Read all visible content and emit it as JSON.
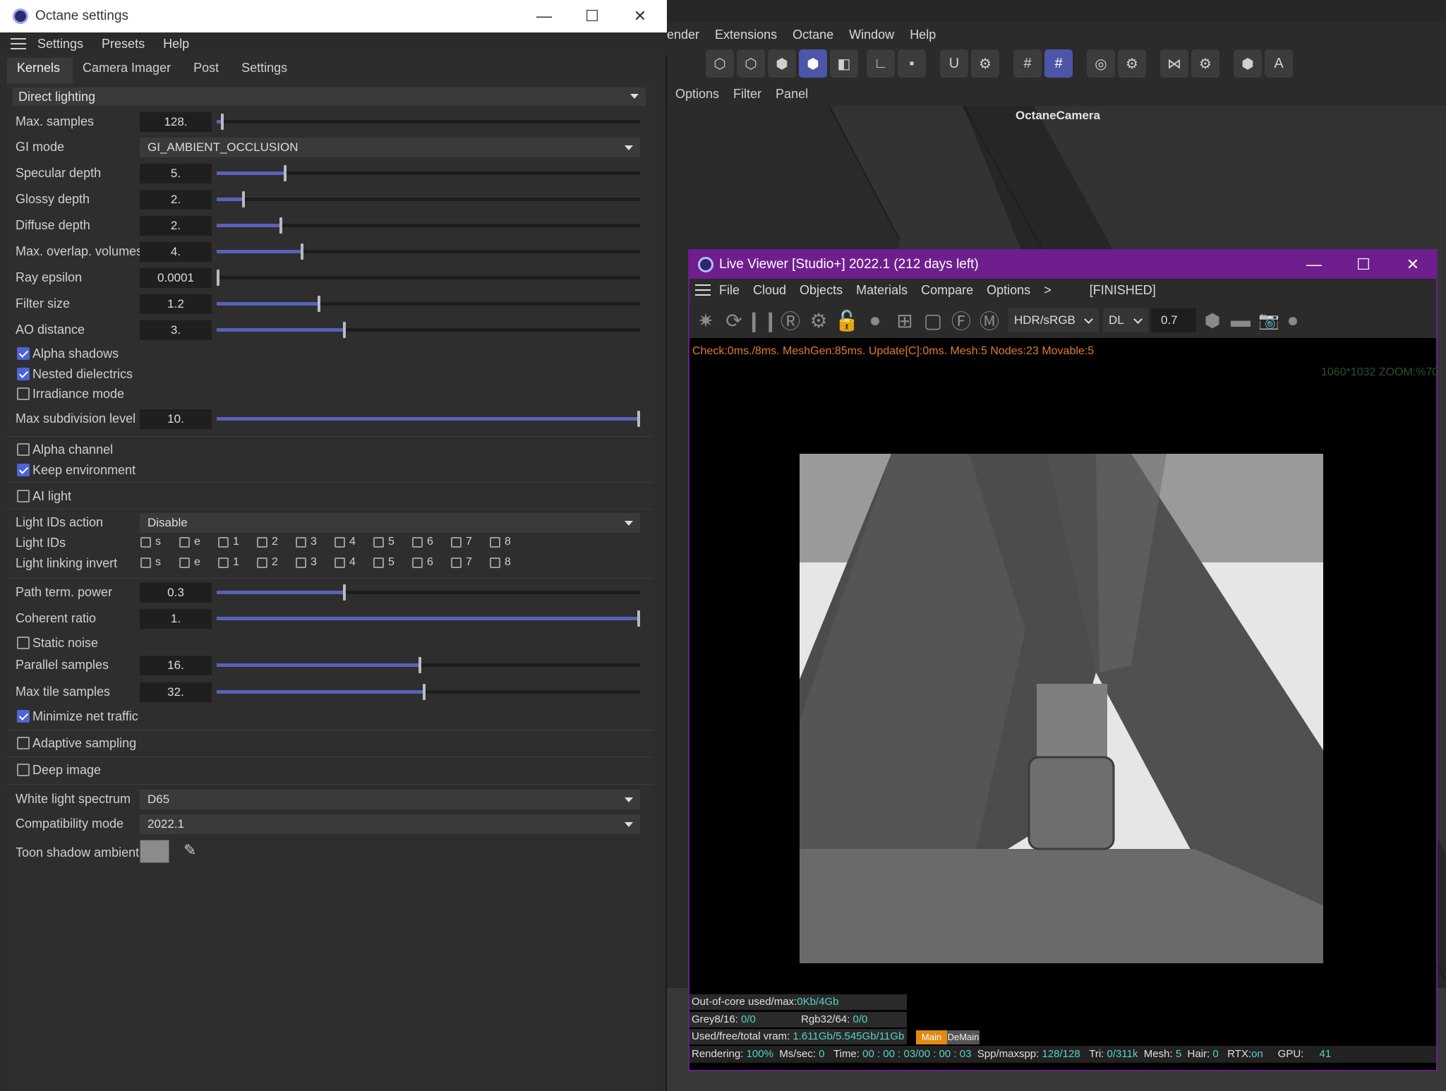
{
  "background_app": {
    "menu": [
      "ender",
      "Extensions",
      "Octane",
      "Window",
      "Help"
    ],
    "viewport_menu": [
      "Options",
      "Filter",
      "Panel"
    ],
    "camera_label": "OctaneCamera"
  },
  "octane_settings": {
    "title": "Octane settings",
    "menu": [
      "Settings",
      "Presets",
      "Help"
    ],
    "tabs": [
      "Kernels",
      "Camera Imager",
      "Post",
      "Settings"
    ],
    "active_tab": "Kernels",
    "kernel": "Direct lighting",
    "params": {
      "max_samples": {
        "label": "Max. samples",
        "value": "128.",
        "fraction": 0.01
      },
      "gi_mode": {
        "label": "GI mode",
        "value": "GI_AMBIENT_OCCLUSION"
      },
      "specular_depth": {
        "label": "Specular depth",
        "value": "5.",
        "fraction": 0.16
      },
      "glossy_depth": {
        "label": "Glossy depth",
        "value": "2.",
        "fraction": 0.06
      },
      "diffuse_depth": {
        "label": "Diffuse depth",
        "value": "2.",
        "fraction": 0.15
      },
      "max_overlap": {
        "label": "Max. overlap. volumes",
        "value": "4.",
        "fraction": 0.2
      },
      "ray_epsilon": {
        "label": "Ray epsilon",
        "value": "0.0001",
        "fraction": 0.0
      },
      "filter_size": {
        "label": "Filter size",
        "value": "1.2",
        "fraction": 0.24
      },
      "ao_distance": {
        "label": "AO distance",
        "value": "3.",
        "fraction": 0.3
      },
      "max_subdivision": {
        "label": "Max subdivision level",
        "value": "10.",
        "fraction": 1.0
      },
      "light_ids_action": {
        "label": "Light IDs action",
        "value": "Disable"
      },
      "light_ids": {
        "label": "Light IDs"
      },
      "light_linking_invert": {
        "label": "Light linking invert"
      },
      "path_term_power": {
        "label": "Path term. power",
        "value": "0.3",
        "fraction": 0.3
      },
      "coherent_ratio": {
        "label": "Coherent ratio",
        "value": "1.",
        "fraction": 1.0
      },
      "parallel_samples": {
        "label": "Parallel samples",
        "value": "16.",
        "fraction": 0.48
      },
      "max_tile_samples": {
        "label": "Max tile samples",
        "value": "32.",
        "fraction": 0.49
      },
      "white_light_spectrum": {
        "label": "White light spectrum",
        "value": "D65"
      },
      "compatibility_mode": {
        "label": "Compatibility mode",
        "value": "2022.1"
      },
      "toon_shadow_ambient": {
        "label": "Toon shadow ambient",
        "color": "#8b8b8b"
      }
    },
    "light_id_channels": [
      "s",
      "e",
      "1",
      "2",
      "3",
      "4",
      "5",
      "6",
      "7",
      "8"
    ],
    "checkboxes": {
      "alpha_shadows": {
        "label": "Alpha shadows",
        "checked": true
      },
      "nested_dielectrics": {
        "label": "Nested dielectrics",
        "checked": true
      },
      "irradiance_mode": {
        "label": "Irradiance mode",
        "checked": false
      },
      "alpha_channel": {
        "label": "Alpha channel",
        "checked": false
      },
      "keep_environment": {
        "label": "Keep environment",
        "checked": true
      },
      "ai_light": {
        "label": "AI light",
        "checked": false
      },
      "static_noise": {
        "label": "Static noise",
        "checked": false
      },
      "minimize_net_traffic": {
        "label": "Minimize net traffic",
        "checked": true
      },
      "adaptive_sampling": {
        "label": "Adaptive sampling",
        "checked": false
      },
      "deep_image": {
        "label": "Deep image",
        "checked": false
      }
    }
  },
  "live_viewer": {
    "title": "Live Viewer [Studio+] 2022.1 (212 days left)",
    "menu": [
      "File",
      "Cloud",
      "Objects",
      "Materials",
      "Compare",
      "Options",
      ">"
    ],
    "status_tag": "[FINISHED]",
    "colorspace": "HDR/sRGB",
    "mode": "DL",
    "exposure": "0.7",
    "stats_line": "Check:0ms./8ms. MeshGen:85ms. Update[C]:0ms. Mesh:5 Nodes:23 Movable:5",
    "resolution_line": "1060*1032 ZOOM:%70",
    "out_of_core": {
      "label": "Out-of-core used/max:",
      "value": "0Kb/4Gb"
    },
    "grey": {
      "label": "Grey8/16:",
      "value": "0/0"
    },
    "rgb": {
      "label": "Rgb32/64:",
      "value": "0/0"
    },
    "vram": {
      "label": "Used/free/total vram:",
      "value": "1.611Gb/5.545Gb/11Gb"
    },
    "tag_main": "Main",
    "tag_demain": "DeMain",
    "status": {
      "rendering_label": "Rendering:",
      "rendering": "100%",
      "ms_label": "Ms/sec:",
      "ms": "0",
      "time_label": "Time:",
      "time": "00 : 00 : 03/00 : 00 : 03",
      "spp_label": "Spp/maxspp:",
      "spp": "128/128",
      "tri_label": "Tri:",
      "tri": "0/311k",
      "mesh_label": "Mesh:",
      "mesh": "5",
      "hair_label": "Hair:",
      "hair": "0",
      "rtx_label": "RTX:",
      "rtx": "on",
      "gpu_label": "GPU:",
      "gpu": "41"
    }
  },
  "colors": {
    "accent": "#5a61b8",
    "viewer_frame": "#6e1f8d",
    "warning_text": "#e27b2c",
    "value_text": "#56d3c3"
  }
}
